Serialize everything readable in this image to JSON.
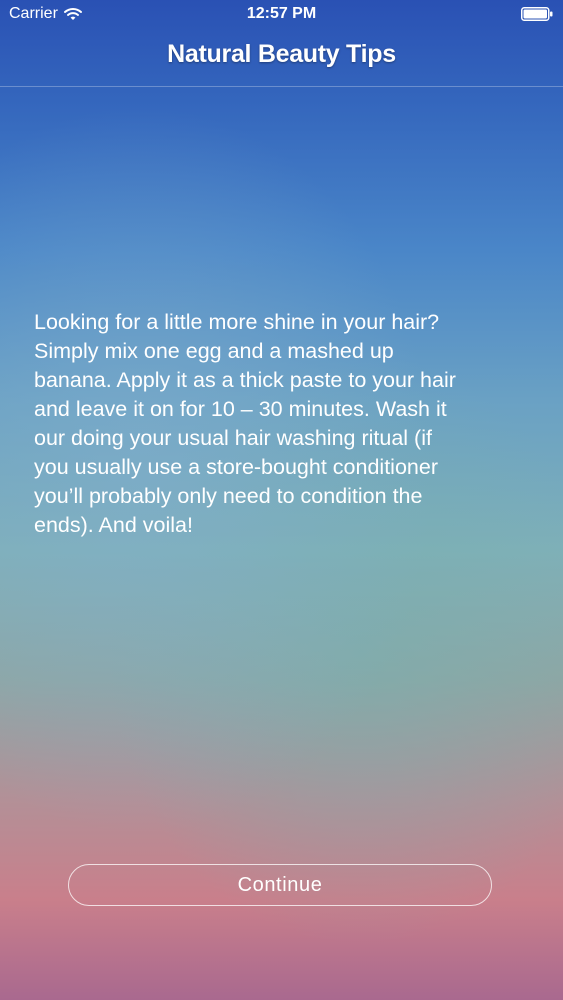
{
  "status_bar": {
    "carrier": "Carrier",
    "wifi_icon": "wifi-icon",
    "time": "12:57 PM",
    "battery_icon": "battery-icon"
  },
  "nav": {
    "title": "Natural Beauty Tips"
  },
  "tip": {
    "text": "Looking for a little more shine in your hair?\nSimply mix one egg and a mashed up\nbanana. Apply it as a thick paste to your hair\nand leave it on for 10 – 30 minutes. Wash it\nour doing your usual hair washing ritual (if\nyou usually use a store-bought conditioner\nyou’ll probably only need to condition the\nends). And voila!"
  },
  "actions": {
    "continue_label": "Continue"
  },
  "colors": {
    "text": "#ffffff",
    "background_top": "#2a51b4",
    "background_bottom": "#a9698f"
  }
}
